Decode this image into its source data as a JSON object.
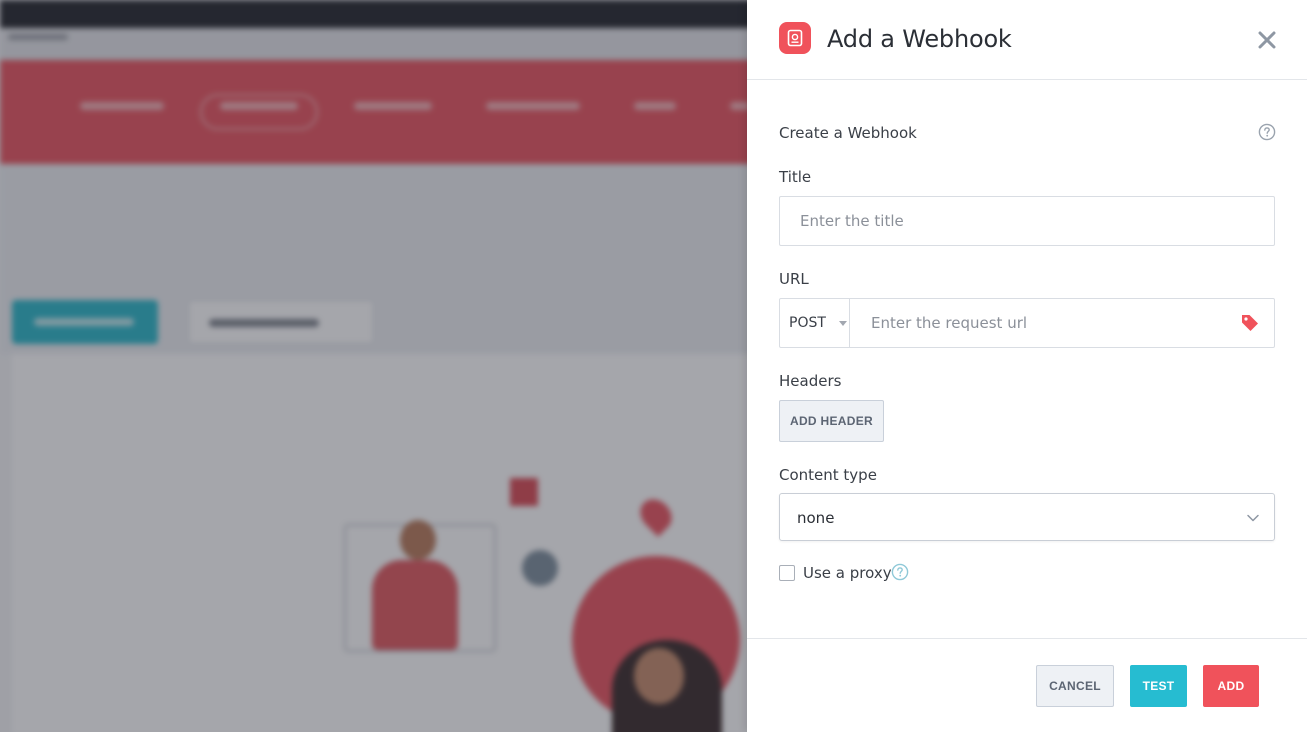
{
  "modal": {
    "title": "Add a Webhook",
    "app_icon": "webhook-app-icon",
    "close_icon": "close-icon",
    "section_label": "Create a Webhook",
    "title_field": {
      "label": "Title",
      "value": "",
      "placeholder": "Enter the title"
    },
    "url_field": {
      "label": "URL",
      "method": "POST",
      "value": "",
      "placeholder": "Enter the request url",
      "tag_icon": "tag-icon"
    },
    "headers": {
      "label": "Headers",
      "add_button": "ADD HEADER"
    },
    "content_type": {
      "label": "Content type",
      "selected": "none"
    },
    "proxy": {
      "label": "Use a proxy",
      "checked": false
    },
    "footer": {
      "cancel": "CANCEL",
      "test": "TEST",
      "add": "ADD"
    }
  },
  "colors": {
    "accent_red": "#f0525b",
    "accent_teal": "#26bcd1",
    "nav_red": "#e9545f",
    "text_dark": "#2b2f36"
  }
}
